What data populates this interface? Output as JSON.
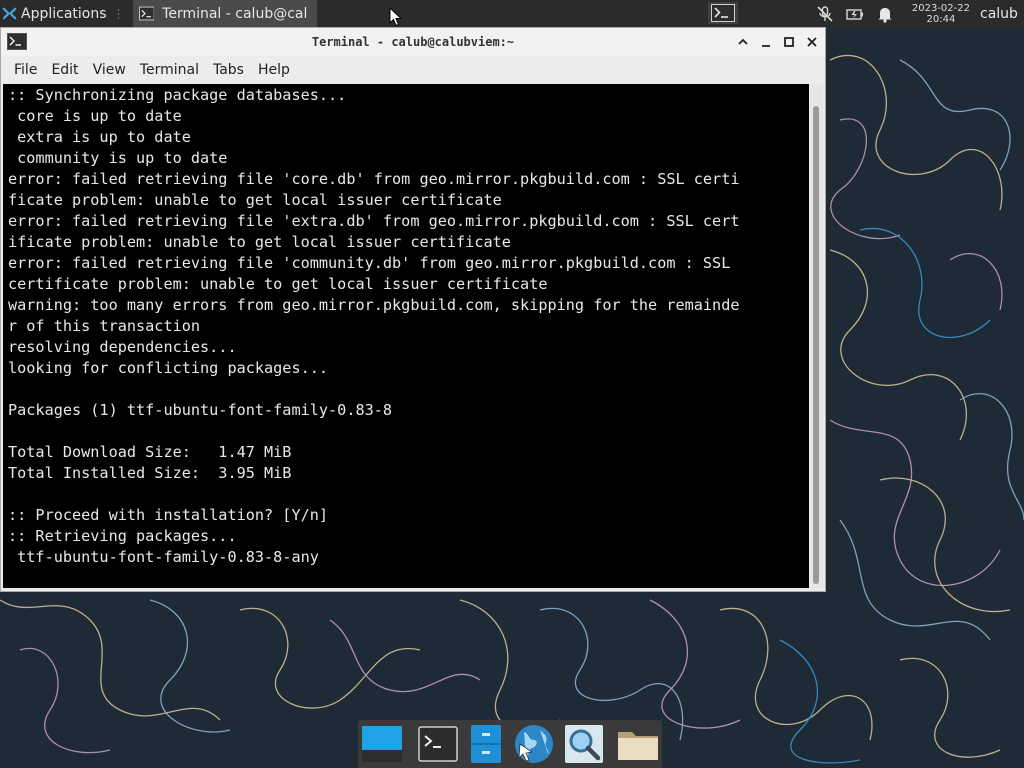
{
  "top_panel": {
    "applications_label": "Applications",
    "task_label": "Terminal - calub@cal…",
    "clock_date": "2023-02-22",
    "clock_time": "20:44",
    "user": "calub"
  },
  "window": {
    "title": "Terminal - calub@calubviem:~",
    "menu": [
      "File",
      "Edit",
      "View",
      "Terminal",
      "Tabs",
      "Help"
    ]
  },
  "terminal": {
    "lines": [
      ":: Synchronizing package databases...",
      " core is up to date",
      " extra is up to date",
      " community is up to date",
      "error: failed retrieving file 'core.db' from geo.mirror.pkgbuild.com : SSL certi",
      "ficate problem: unable to get local issuer certificate",
      "error: failed retrieving file 'extra.db' from geo.mirror.pkgbuild.com : SSL cert",
      "ificate problem: unable to get local issuer certificate",
      "error: failed retrieving file 'community.db' from geo.mirror.pkgbuild.com : SSL",
      "certificate problem: unable to get local issuer certificate",
      "warning: too many errors from geo.mirror.pkgbuild.com, skipping for the remainde",
      "r of this transaction",
      "resolving dependencies...",
      "looking for conflicting packages...",
      "",
      "Packages (1) ttf-ubuntu-font-family-0.83-8",
      "",
      "Total Download Size:   1.47 MiB",
      "Total Installed Size:  3.95 MiB",
      "",
      ":: Proceed with installation? [Y/n]",
      ":: Retrieving packages...",
      " ttf-ubuntu-font-family-0.83-8-any"
    ]
  },
  "icons": {
    "apps": "xfce-mouse-icon",
    "task": "terminal-icon",
    "tray": [
      "mic-muted-icon",
      "battery-icon",
      "notification-bell-icon"
    ],
    "dock": [
      "show-desktop-icon",
      "terminal-icon",
      "file-manager-icon",
      "web-browser-icon",
      "app-finder-icon",
      "folder-icon"
    ]
  },
  "colors": {
    "panel_bg": "#2b2b2b",
    "terminal_bg": "#000000",
    "terminal_fg": "#e8e8e8",
    "wallpaper_bg": "#1e2a36"
  }
}
